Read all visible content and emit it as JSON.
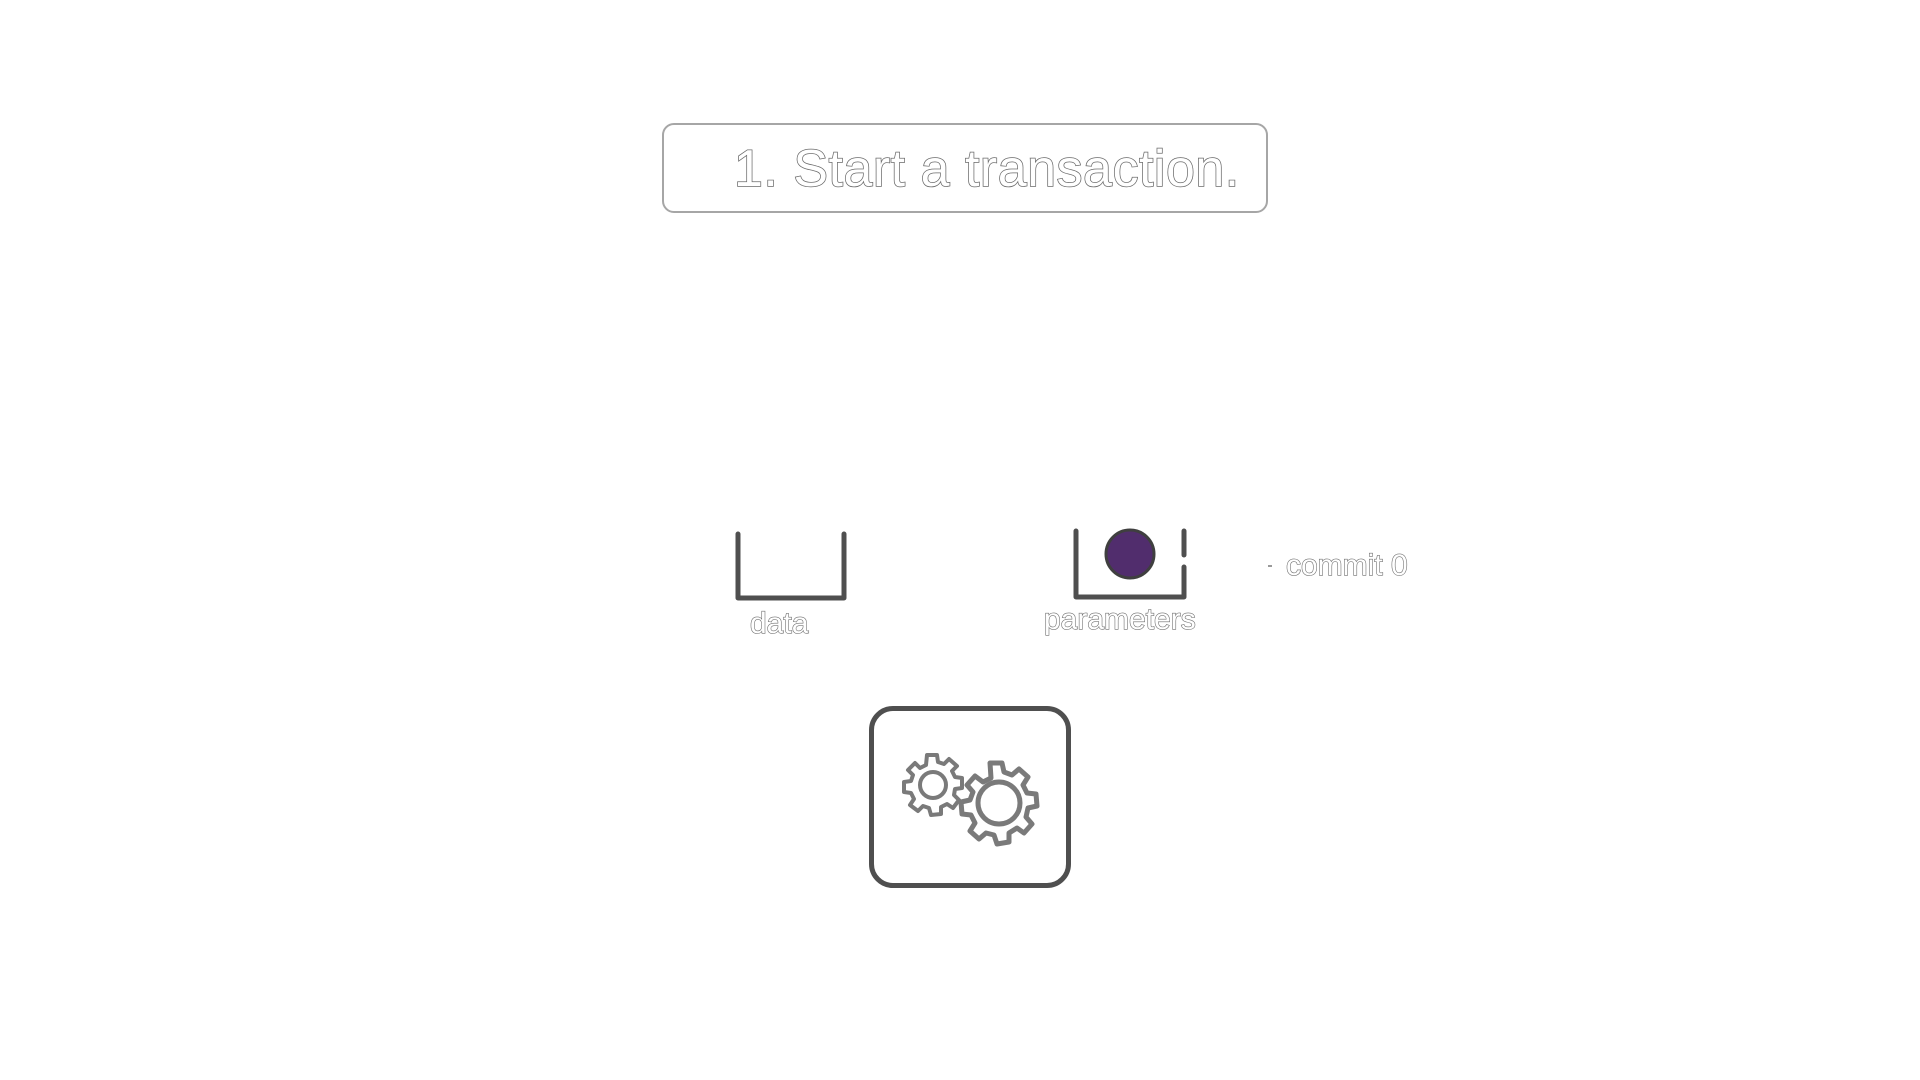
{
  "title": "1. Start a transaction.",
  "containers": [
    {
      "id": "data",
      "label": "data",
      "items": []
    },
    {
      "id": "parameters",
      "label": "parameters",
      "items": [
        {
          "color": "#512d6d"
        }
      ]
    }
  ],
  "commit_label": "commit 0",
  "engine": {
    "icon": "gears-icon"
  },
  "colors": {
    "outline": "#6f6f6f",
    "container_stroke": "#4f4f4f",
    "parameter_ball": "#512d6d",
    "gear_stroke": "#7a7a7a"
  }
}
